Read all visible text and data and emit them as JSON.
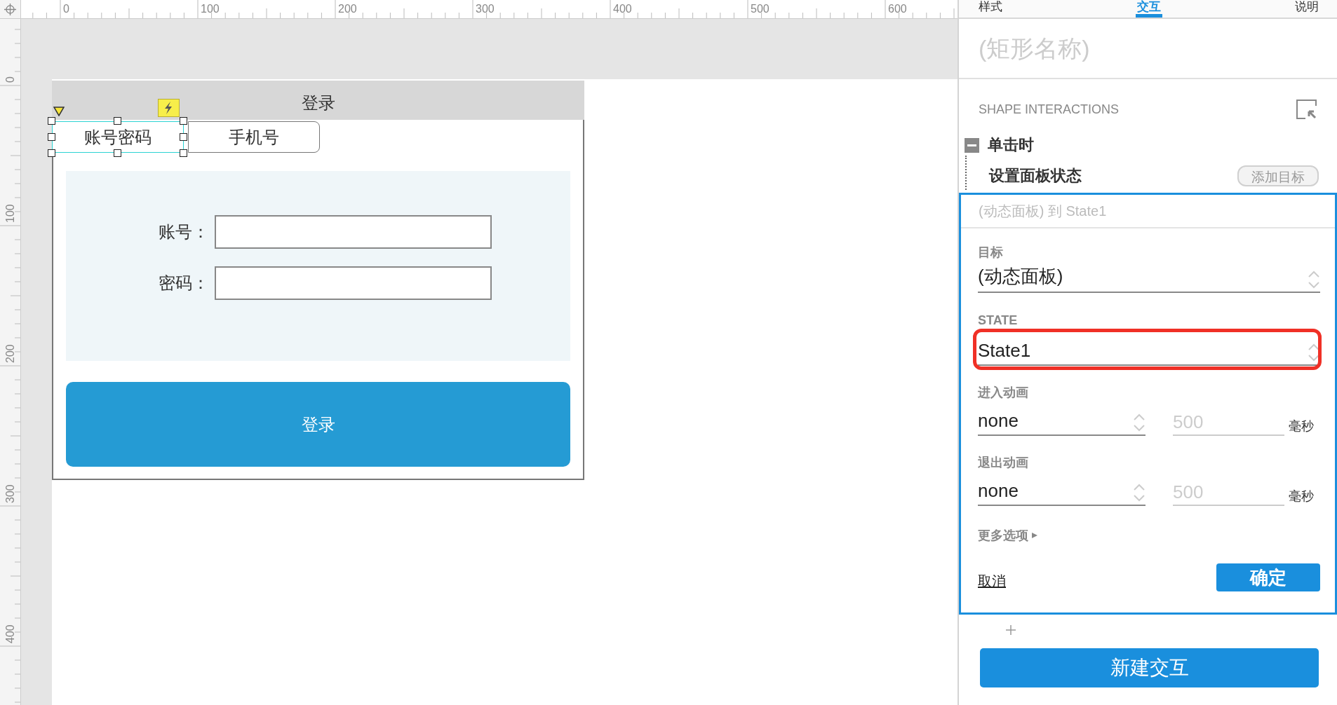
{
  "rulers": {
    "top_labels": [
      "0",
      "100",
      "200",
      "300",
      "400",
      "500",
      "600"
    ],
    "left_labels": [
      "0",
      "100",
      "200",
      "300",
      "400"
    ]
  },
  "prototype": {
    "title": "登录",
    "tabs": [
      {
        "label": "账号密码",
        "selected": true
      },
      {
        "label": "手机号",
        "selected": false
      }
    ],
    "fields": [
      {
        "label": "账号："
      },
      {
        "label": "密码："
      }
    ],
    "button": "登录"
  },
  "panel": {
    "tabs": [
      {
        "label": "样式",
        "selected": false
      },
      {
        "label": "交互",
        "selected": true
      },
      {
        "label": "说明",
        "selected": false
      }
    ],
    "name_placeholder": "(矩形名称)",
    "section_title": "SHAPE INTERACTIONS",
    "event": {
      "label": "单击时",
      "expanded": true
    },
    "action": {
      "label": "设置面板状态",
      "add_button": "添加目标"
    },
    "editor": {
      "summary": "(动态面板) 到 State1",
      "target_label": "目标",
      "target_value": "(动态面板)",
      "state_label": "STATE",
      "state_value": "State1",
      "state_highlighted": true,
      "animations": [
        {
          "label": "进入动画",
          "value": "none",
          "duration_placeholder": "500",
          "unit": "毫秒"
        },
        {
          "label": "退出动画",
          "value": "none",
          "duration_placeholder": "500",
          "unit": "毫秒"
        }
      ],
      "more_options": "更多选项",
      "cancel": "取消",
      "ok": "确定"
    },
    "new_button": "新建交互"
  }
}
